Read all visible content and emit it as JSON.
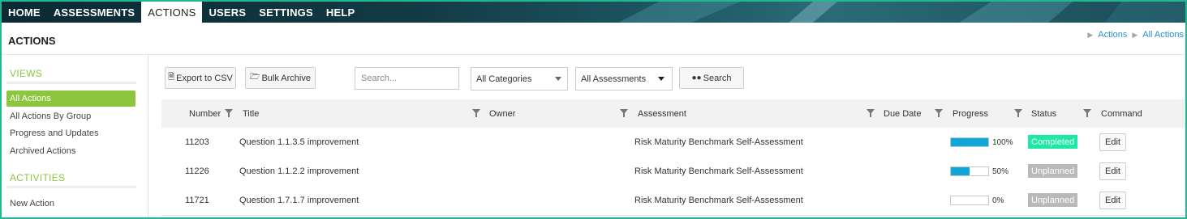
{
  "nav": {
    "items": [
      {
        "label": "HOME",
        "active": false
      },
      {
        "label": "ASSESSMENTS",
        "active": false
      },
      {
        "label": "ACTIONS",
        "active": true
      },
      {
        "label": "USERS",
        "active": false
      },
      {
        "label": "SETTINGS",
        "active": false
      },
      {
        "label": "HELP",
        "active": false
      }
    ]
  },
  "header": {
    "title": "ACTIONS",
    "breadcrumb": [
      "Actions",
      "All Actions"
    ]
  },
  "sidebar": {
    "views_heading": "VIEWS",
    "views": [
      "All Actions",
      "All Actions By Group",
      "Progress and Updates",
      "Archived Actions"
    ],
    "activities_heading": "ACTIVITIES",
    "activities": [
      "New Action"
    ]
  },
  "toolbar": {
    "export_label": "Export to CSV",
    "bulk_archive_label": "Bulk Archive",
    "search_placeholder": "Search...",
    "categories_selected": "All Categories",
    "assessments_selected": "All Assessments",
    "search_button_label": "Search"
  },
  "table": {
    "columns": [
      "Number",
      "Title",
      "Owner",
      "Assessment",
      "Due Date",
      "Progress",
      "Status",
      "Command"
    ],
    "rows": [
      {
        "number": "11203",
        "title": "Question 1.1.3.5 improvement",
        "owner": "",
        "assessment": "Risk Maturity Benchmark Self-Assessment",
        "due_date": "",
        "progress": 100,
        "progress_label": "100%",
        "status": "Completed",
        "command": "Edit"
      },
      {
        "number": "11226",
        "title": "Question 1.1.2.2 improvement",
        "owner": "",
        "assessment": "Risk Maturity Benchmark Self-Assessment",
        "due_date": "",
        "progress": 50,
        "progress_label": "50%",
        "status": "Unplanned",
        "command": "Edit"
      },
      {
        "number": "11721",
        "title": "Question 1.7.1.7 improvement",
        "owner": "",
        "assessment": "Risk Maturity Benchmark Self-Assessment",
        "due_date": "",
        "progress": 0,
        "progress_label": "0%",
        "status": "Unplanned",
        "command": "Edit"
      }
    ]
  },
  "colors": {
    "accent_green": "#8cc63f",
    "completed": "#1de9a6",
    "unplanned": "#b9b9b9",
    "progress_fill": "#11a6d8",
    "frame": "#1fb890"
  }
}
